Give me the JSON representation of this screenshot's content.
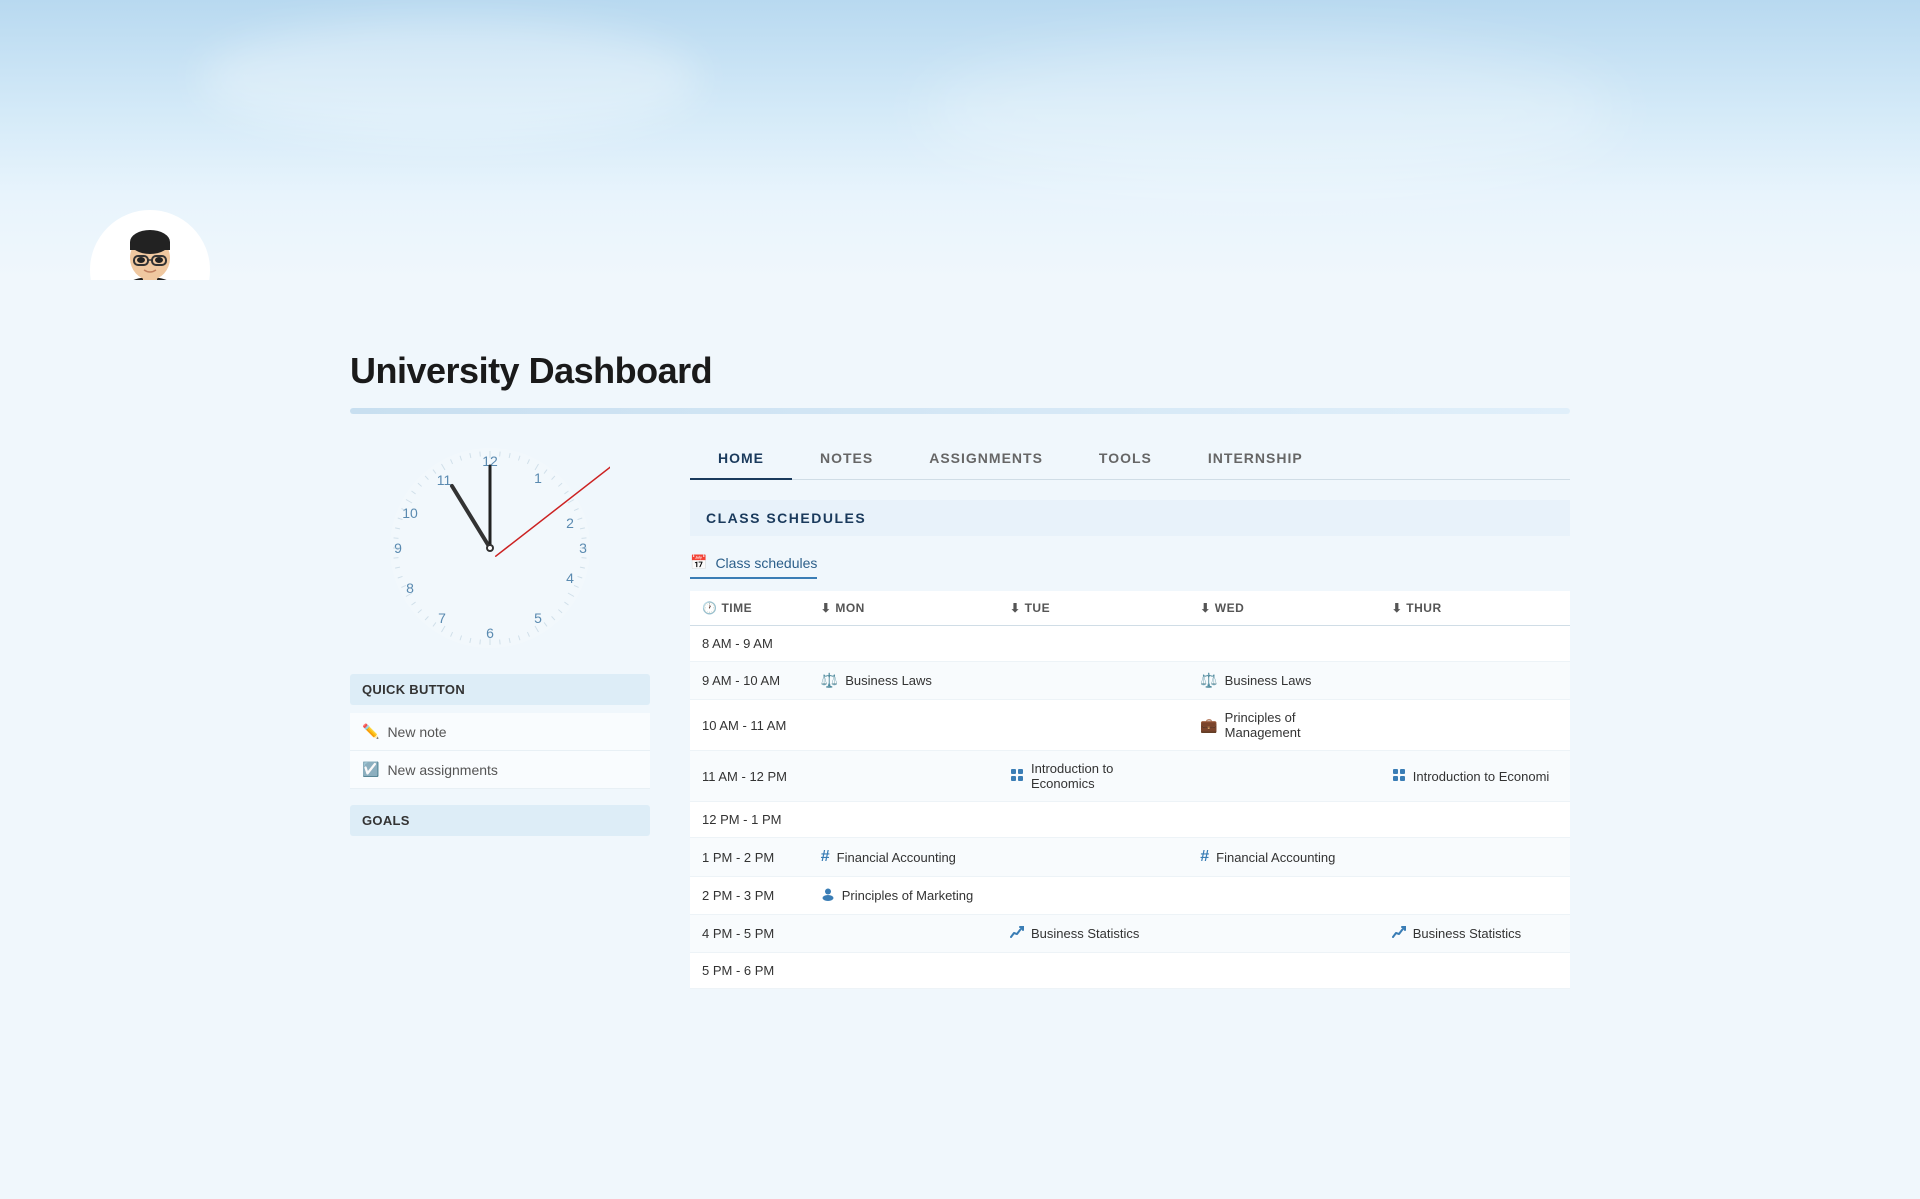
{
  "header": {
    "title": "University Dashboard",
    "banner_alt": "Sky background"
  },
  "nav": {
    "tabs": [
      {
        "label": "HOME",
        "active": true
      },
      {
        "label": "NOTES",
        "active": false
      },
      {
        "label": "ASSIGNMENTS",
        "active": false
      },
      {
        "label": "TOOLS",
        "active": false
      },
      {
        "label": "INTERNSHIP",
        "active": false
      }
    ]
  },
  "quick_button": {
    "header": "QUICK BUTTON",
    "buttons": [
      {
        "label": "New note",
        "icon": "✏️"
      },
      {
        "label": "New assignments",
        "icon": "☑️"
      }
    ]
  },
  "goals": {
    "header": "GOALS"
  },
  "schedules": {
    "section_title": "CLASS SCHEDULES",
    "tab_label": "Class schedules",
    "columns": [
      {
        "label": "TIME",
        "has_icon": true
      },
      {
        "label": "MON",
        "has_arrow": true
      },
      {
        "label": "TUE",
        "has_arrow": true
      },
      {
        "label": "WED",
        "has_arrow": true
      },
      {
        "label": "THUR",
        "has_arrow": true
      }
    ],
    "rows": [
      {
        "time": "8 AM - 9 AM",
        "mon": null,
        "tue": null,
        "wed": null,
        "thur": null
      },
      {
        "time": "9 AM - 10 AM",
        "mon": {
          "label": "Business Laws",
          "icon": "⚖️",
          "icon_class": "icon-blue"
        },
        "tue": null,
        "wed": {
          "label": "Business Laws",
          "icon": "⚖️",
          "icon_class": "icon-blue"
        },
        "thur": null
      },
      {
        "time": "10 AM - 11 AM",
        "mon": null,
        "tue": null,
        "wed": {
          "label": "Principles of Management",
          "icon": "💼",
          "icon_class": "icon-blue"
        },
        "thur": null
      },
      {
        "time": "11 AM - 12 PM",
        "mon": null,
        "tue": {
          "label": "Introduction to Economics",
          "icon": "🔢",
          "icon_class": "icon-blue"
        },
        "wed": null,
        "thur": {
          "label": "Introduction to Economi",
          "icon": "🔢",
          "icon_class": "icon-blue"
        }
      },
      {
        "time": "12 PM - 1 PM",
        "mon": null,
        "tue": null,
        "wed": null,
        "thur": null
      },
      {
        "time": "1 PM - 2 PM",
        "mon": {
          "label": "Financial Accounting",
          "icon": "#",
          "icon_class": "icon-blue"
        },
        "tue": null,
        "wed": {
          "label": "Financial Accounting",
          "icon": "#",
          "icon_class": "icon-blue"
        },
        "thur": null
      },
      {
        "time": "2 PM - 3 PM",
        "mon": {
          "label": "Principles of Marketing",
          "icon": "👤",
          "icon_class": "icon-blue"
        },
        "tue": null,
        "wed": null,
        "thur": null
      },
      {
        "time": "4 PM - 5 PM",
        "mon": null,
        "tue": {
          "label": "Business Statistics",
          "icon": "📈",
          "icon_class": "icon-blue"
        },
        "wed": null,
        "thur": {
          "label": "Business Statistics",
          "icon": "📈",
          "icon_class": "icon-blue"
        }
      },
      {
        "time": "5 PM - 6 PM",
        "mon": null,
        "tue": null,
        "wed": null,
        "thur": null
      }
    ]
  }
}
